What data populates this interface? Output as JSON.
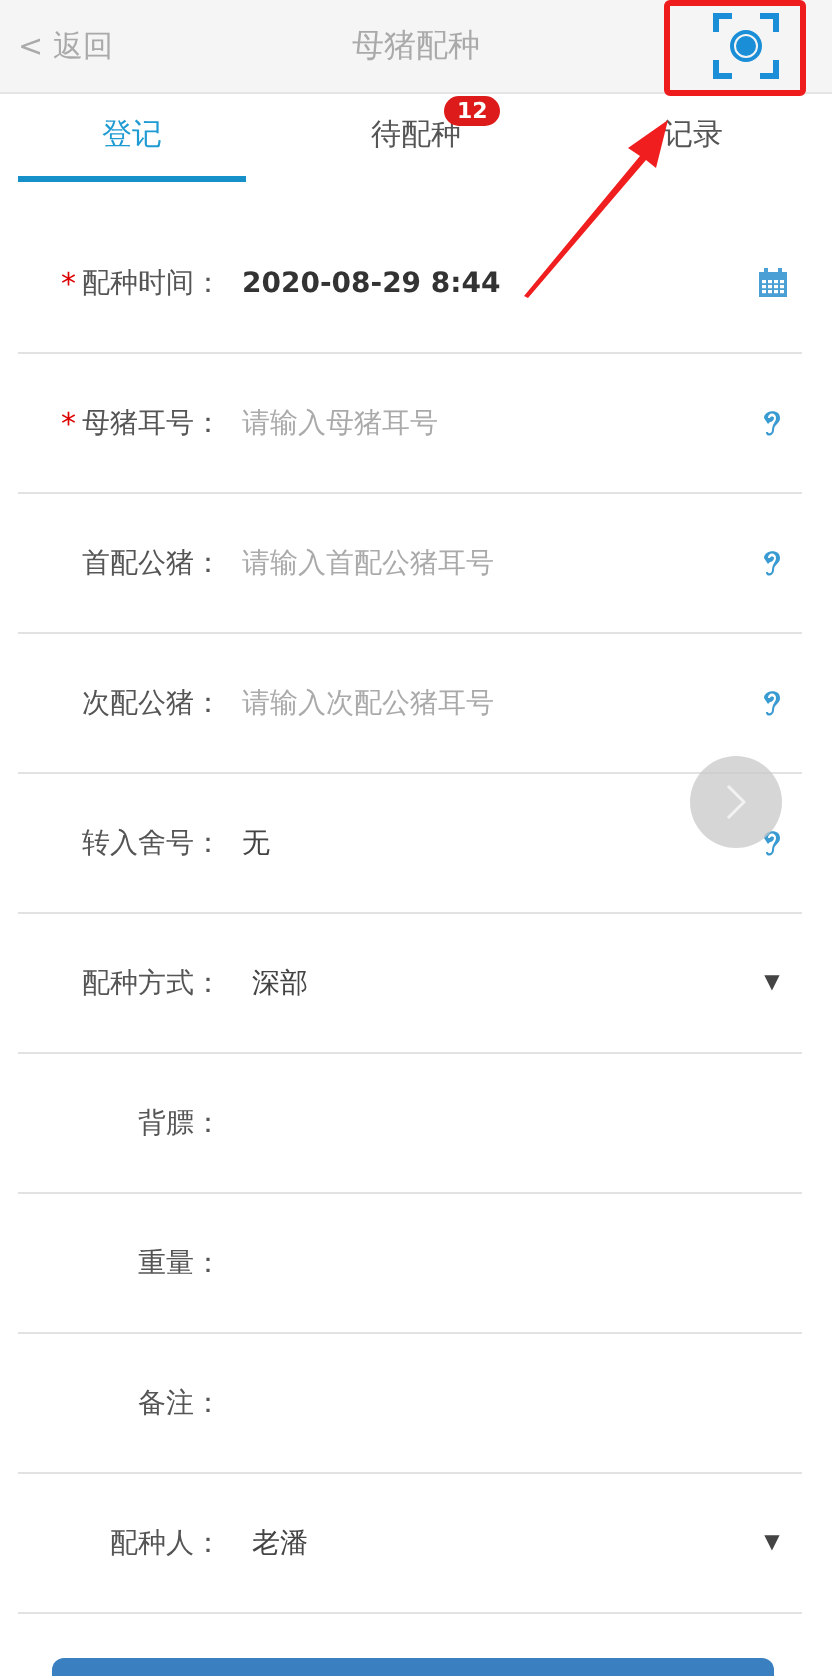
{
  "header": {
    "back": "< 返回",
    "title": "母猪配种"
  },
  "annotations": {
    "highlight_scan": true,
    "arrow_to_records": true
  },
  "tabs": [
    {
      "label": "登记",
      "selected": true
    },
    {
      "label": "待配种",
      "selected": false,
      "badge": "12"
    },
    {
      "label": "记录",
      "selected": false
    }
  ],
  "form": [
    {
      "kind": "date",
      "required_mark": "*",
      "label": "配种时间：",
      "value": "2020-08-29 8:44"
    },
    {
      "kind": "ear",
      "required_mark": "*",
      "label": "母猪耳号：",
      "placeholder": "请输入母猪耳号"
    },
    {
      "kind": "ear",
      "label": "首配公猪：",
      "placeholder": "请输入首配公猪耳号"
    },
    {
      "kind": "ear",
      "label": "次配公猪：",
      "placeholder": "请输入次配公猪耳号"
    },
    {
      "kind": "ear",
      "label": "转入舍号：",
      "value": "无"
    },
    {
      "kind": "select",
      "label": "配种方式：",
      "value": "深部",
      "arrow": "▼"
    },
    {
      "kind": "text",
      "label": "背膘："
    },
    {
      "kind": "text",
      "label": "重量："
    },
    {
      "kind": "text",
      "label": "备注："
    },
    {
      "kind": "select",
      "label": "配种人：",
      "value": "老潘",
      "arrow": "▼"
    }
  ]
}
